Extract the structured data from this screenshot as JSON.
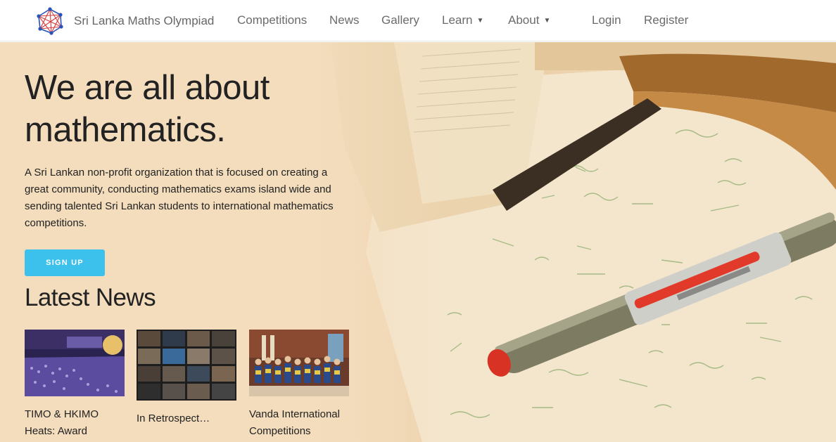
{
  "brand": {
    "name": "Sri Lanka Maths Olympiad",
    "logo_icon": "network-logo-icon"
  },
  "nav": {
    "items": [
      {
        "label": "Competitions",
        "dropdown": false
      },
      {
        "label": "News",
        "dropdown": false
      },
      {
        "label": "Gallery",
        "dropdown": false
      },
      {
        "label": "Learn",
        "dropdown": true,
        "caret": "▼"
      },
      {
        "label": "About",
        "dropdown": true,
        "caret": "▼"
      }
    ],
    "login": "Login",
    "register": "Register"
  },
  "hero": {
    "headline_line1": "We are all about",
    "headline_line2": "mathematics.",
    "description": "A Sri Lankan non-profit organization that is focused on creating a great community, conducting mathematics exams island wide and sending talented Sri Lankan students to international mathematics competitions.",
    "cta": "SIGN UP"
  },
  "news": {
    "heading": "Latest News",
    "items": [
      {
        "title": "TIMO & HKIMO Heats: Award",
        "image": "auditorium-award-ceremony-photo"
      },
      {
        "title": "In Retrospect…",
        "image": "video-call-grid-photo"
      },
      {
        "title": "Vanda International Competitions",
        "image": "students-group-photo"
      }
    ]
  },
  "colors": {
    "accent": "#3cc0ec",
    "hero_bg": "#f3ddbd",
    "nav_text": "#6b6b6b"
  }
}
